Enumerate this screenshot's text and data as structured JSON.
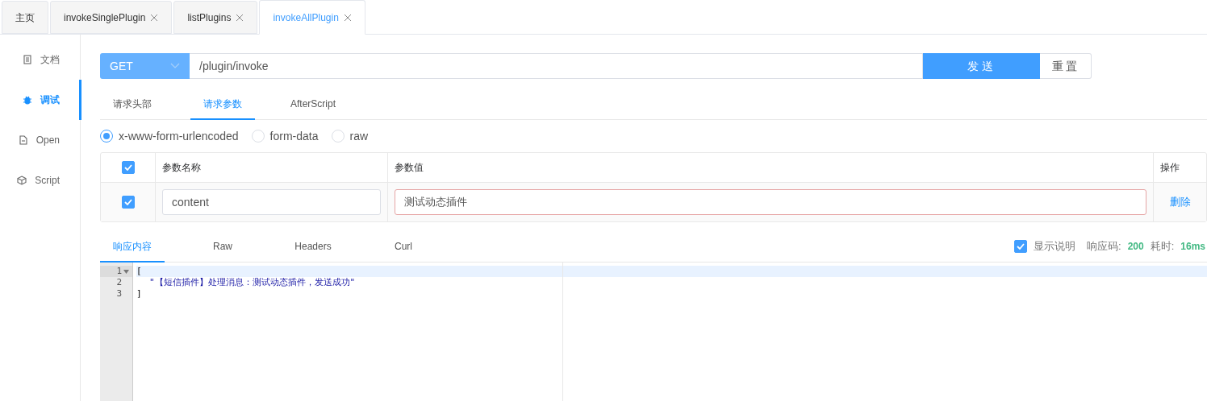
{
  "tabs": [
    {
      "label": "主页",
      "selected": false,
      "closable": false
    },
    {
      "label": "invokeSinglePlugin",
      "selected": false,
      "closable": true
    },
    {
      "label": "listPlugins",
      "selected": false,
      "closable": true
    },
    {
      "label": "invokeAllPlugin",
      "selected": true,
      "closable": true
    }
  ],
  "sidebar": {
    "items": [
      {
        "label": "文档",
        "kind": "doc",
        "selected": false
      },
      {
        "label": "调试",
        "kind": "debug",
        "selected": true
      },
      {
        "label": "Open",
        "kind": "open",
        "selected": false
      },
      {
        "label": "Script",
        "kind": "script",
        "selected": false
      }
    ]
  },
  "request": {
    "method": "GET",
    "url": "/plugin/invoke",
    "send": "发送",
    "reset": "重置"
  },
  "request_tabs": [
    {
      "label": "请求头部",
      "selected": false
    },
    {
      "label": "请求参数",
      "selected": true
    },
    {
      "label": "AfterScript",
      "selected": false
    }
  ],
  "body_types": [
    {
      "label": "x-www-form-urlencoded",
      "selected": true
    },
    {
      "label": "form-data",
      "selected": false
    },
    {
      "label": "raw",
      "selected": false
    }
  ],
  "params": {
    "all_checked": true,
    "columns": [
      "参数名称",
      "参数值",
      "操作"
    ],
    "rows": [
      {
        "checked": true,
        "name": "content",
        "value": "测试动态插件",
        "action": "删除"
      }
    ]
  },
  "response_tabs": [
    {
      "label": "响应内容",
      "selected": true
    },
    {
      "label": "Raw",
      "selected": false
    },
    {
      "label": "Headers",
      "selected": false
    },
    {
      "label": "Curl",
      "selected": false
    }
  ],
  "response_info": {
    "show_desc": {
      "label": "显示说明",
      "checked": true
    },
    "code_label": "响应码:",
    "code": "200",
    "time_label": "耗时:",
    "time": "16ms"
  },
  "editor": {
    "lines": [
      {
        "number": "1",
        "text": "[",
        "foldable": true,
        "kind": "punct"
      },
      {
        "number": "2",
        "text": "\"【短信插件】处理消息：测试动态插件，发送成功\"",
        "foldable": false,
        "kind": "string"
      },
      {
        "number": "3",
        "text": "]",
        "foldable": false,
        "kind": "punct"
      }
    ]
  }
}
